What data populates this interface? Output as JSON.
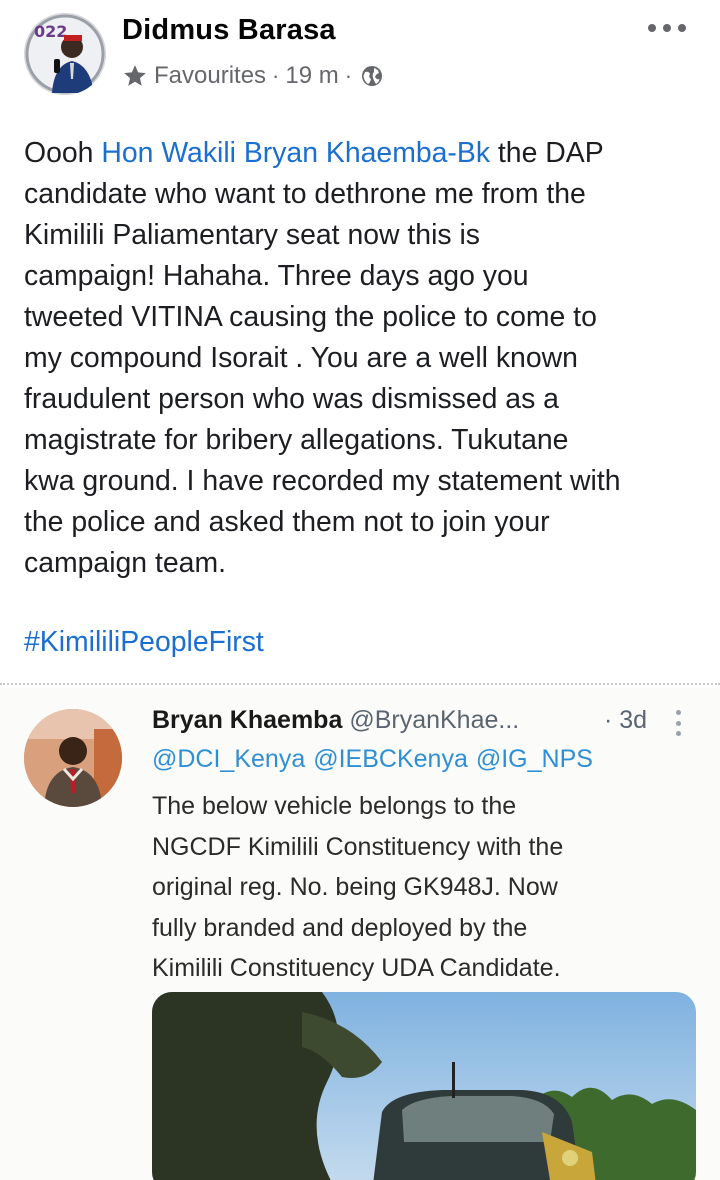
{
  "post": {
    "author": "Didmus Barasa",
    "audience": "Favourites",
    "time": "19 m",
    "separator": "·",
    "text_before_mention": "Oooh ",
    "mention": "Hon Wakili Bryan Khaemba-Bk",
    "text_after_mention": "  the DAP\ncandidate who want to dethrone me from the\nKimilili Paliamentary seat now this is\ncampaign! Hahaha.  Three days ago you\ntweeted VITINA causing the police to come to\nmy compound Isorait . You are a well known\nfraudulent person who was dismissed as a\nmagistrate for bribery allegations. Tukutane\nkwa ground. I have recorded my statement with\nthe police and asked them not to join your\ncampaign team.",
    "hashtag": "#KimililiPeopleFirst"
  },
  "tweet": {
    "name": "Bryan Khaemba",
    "handle": "@BryanKhae...",
    "time": "· 3d",
    "mentions": [
      "@DCI_Kenya",
      "@IEBCKenya",
      "@IG_NPS"
    ],
    "body": "The below vehicle belongs to the\nNGCDF Kimilili Constituency with the\noriginal reg. No. being GK948J. Now\nfully branded and deployed by the\nKimilili Constituency UDA Candidate."
  },
  "icons": {
    "audience": "star-icon",
    "privacy": "globe-icon",
    "menu": "more-options-icon",
    "tweet_menu": "kebab-icon"
  },
  "colors": {
    "link": "#1b6fd0",
    "meta": "#65676b",
    "twitter_link": "#2f8fd4"
  }
}
